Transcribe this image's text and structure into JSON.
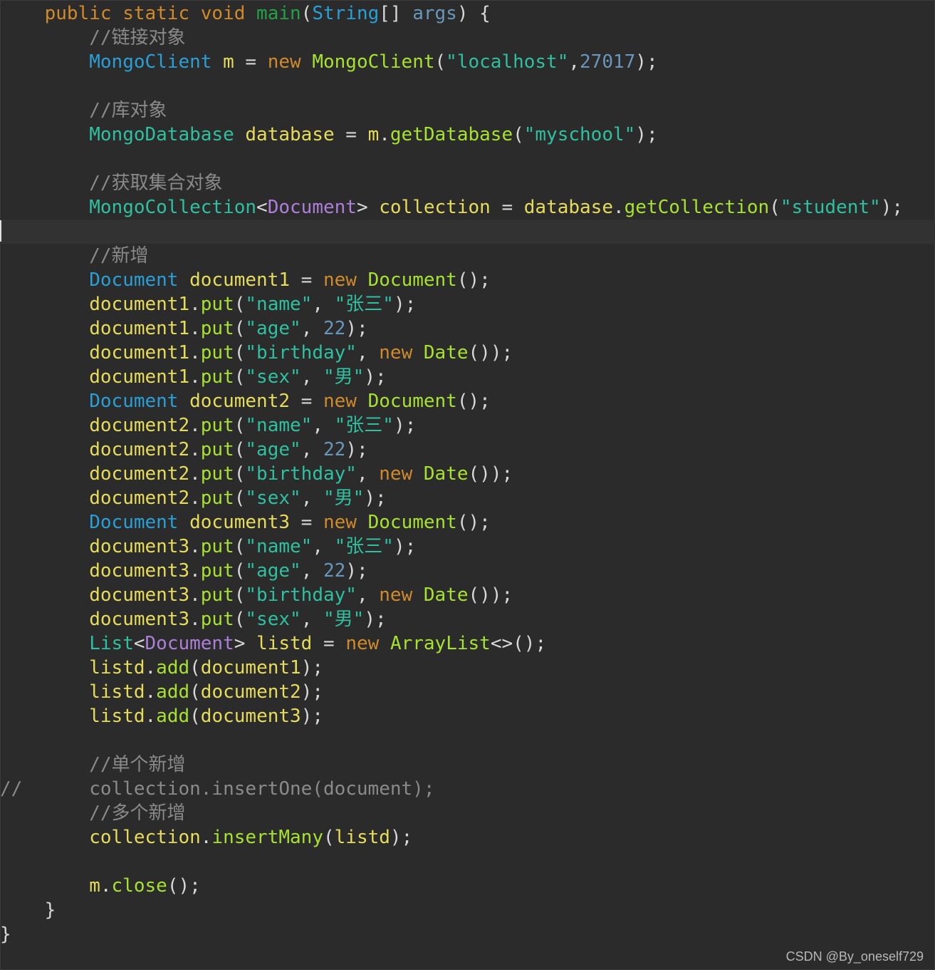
{
  "editor": {
    "theme_colors": {
      "background": "#2b2b2b",
      "keyword": "#d08a2a",
      "method_decl": "#22a246",
      "type": "#2a9fd6",
      "type_generic": "#ad7fd8",
      "variable": "#e6dc5a",
      "method_call": "#a6e22e",
      "string": "#2ec0a0",
      "number": "#6897bb",
      "comment": "#8a8a8a",
      "plain": "#d8d8d8"
    },
    "current_line_index": 9,
    "lines": [
      [
        {
          "t": "    "
        },
        {
          "t": "public static void ",
          "c": "keyword"
        },
        {
          "t": "main",
          "c": "method_decl"
        },
        {
          "t": "("
        },
        {
          "t": "String",
          "c": "type"
        },
        {
          "t": "[] "
        },
        {
          "t": "args",
          "c": "number"
        },
        {
          "t": ") {"
        }
      ],
      [
        {
          "t": "        "
        },
        {
          "t": "//链接对象",
          "c": "comment"
        }
      ],
      [
        {
          "t": "        "
        },
        {
          "t": "MongoClient",
          "c": "type"
        },
        {
          "t": " "
        },
        {
          "t": "m",
          "c": "variable"
        },
        {
          "t": " = "
        },
        {
          "t": "new ",
          "c": "keyword"
        },
        {
          "t": "MongoClient",
          "c": "method_call"
        },
        {
          "t": "("
        },
        {
          "t": "\"localhost\"",
          "c": "string"
        },
        {
          "t": ","
        },
        {
          "t": "27017",
          "c": "number"
        },
        {
          "t": ");"
        }
      ],
      [
        {
          "t": ""
        }
      ],
      [
        {
          "t": "        "
        },
        {
          "t": "//库对象",
          "c": "comment"
        }
      ],
      [
        {
          "t": "        "
        },
        {
          "t": "MongoDatabase",
          "c": "string"
        },
        {
          "t": " "
        },
        {
          "t": "database",
          "c": "variable"
        },
        {
          "t": " = "
        },
        {
          "t": "m",
          "c": "variable"
        },
        {
          "t": "."
        },
        {
          "t": "getDatabase",
          "c": "method_call"
        },
        {
          "t": "("
        },
        {
          "t": "\"myschool\"",
          "c": "string"
        },
        {
          "t": ");"
        }
      ],
      [
        {
          "t": ""
        }
      ],
      [
        {
          "t": "        "
        },
        {
          "t": "//获取集合对象",
          "c": "comment"
        }
      ],
      [
        {
          "t": "        "
        },
        {
          "t": "MongoCollection",
          "c": "string"
        },
        {
          "t": "<"
        },
        {
          "t": "Document",
          "c": "type_generic"
        },
        {
          "t": "> "
        },
        {
          "t": "collection",
          "c": "variable"
        },
        {
          "t": " = "
        },
        {
          "t": "database",
          "c": "variable"
        },
        {
          "t": "."
        },
        {
          "t": "getCollection",
          "c": "method_call"
        },
        {
          "t": "("
        },
        {
          "t": "\"student\"",
          "c": "string"
        },
        {
          "t": ");"
        }
      ],
      [
        {
          "t": ""
        }
      ],
      [
        {
          "t": "        "
        },
        {
          "t": "//新增",
          "c": "comment"
        }
      ],
      [
        {
          "t": "        "
        },
        {
          "t": "Document",
          "c": "type"
        },
        {
          "t": " "
        },
        {
          "t": "document1",
          "c": "variable"
        },
        {
          "t": " = "
        },
        {
          "t": "new ",
          "c": "keyword"
        },
        {
          "t": "Document",
          "c": "method_call"
        },
        {
          "t": "();"
        }
      ],
      [
        {
          "t": "        "
        },
        {
          "t": "document1",
          "c": "variable"
        },
        {
          "t": "."
        },
        {
          "t": "put",
          "c": "method_call"
        },
        {
          "t": "("
        },
        {
          "t": "\"name\"",
          "c": "string"
        },
        {
          "t": ", "
        },
        {
          "t": "\"张三\"",
          "c": "string"
        },
        {
          "t": ");"
        }
      ],
      [
        {
          "t": "        "
        },
        {
          "t": "document1",
          "c": "variable"
        },
        {
          "t": "."
        },
        {
          "t": "put",
          "c": "method_call"
        },
        {
          "t": "("
        },
        {
          "t": "\"age\"",
          "c": "string"
        },
        {
          "t": ", "
        },
        {
          "t": "22",
          "c": "number"
        },
        {
          "t": ");"
        }
      ],
      [
        {
          "t": "        "
        },
        {
          "t": "document1",
          "c": "variable"
        },
        {
          "t": "."
        },
        {
          "t": "put",
          "c": "method_call"
        },
        {
          "t": "("
        },
        {
          "t": "\"birthday\"",
          "c": "string"
        },
        {
          "t": ", "
        },
        {
          "t": "new ",
          "c": "keyword"
        },
        {
          "t": "Date",
          "c": "method_call"
        },
        {
          "t": "());"
        }
      ],
      [
        {
          "t": "        "
        },
        {
          "t": "document1",
          "c": "variable"
        },
        {
          "t": "."
        },
        {
          "t": "put",
          "c": "method_call"
        },
        {
          "t": "("
        },
        {
          "t": "\"sex\"",
          "c": "string"
        },
        {
          "t": ", "
        },
        {
          "t": "\"男\"",
          "c": "string"
        },
        {
          "t": ");"
        }
      ],
      [
        {
          "t": "        "
        },
        {
          "t": "Document",
          "c": "type"
        },
        {
          "t": " "
        },
        {
          "t": "document2",
          "c": "variable"
        },
        {
          "t": " = "
        },
        {
          "t": "new ",
          "c": "keyword"
        },
        {
          "t": "Document",
          "c": "method_call"
        },
        {
          "t": "();"
        }
      ],
      [
        {
          "t": "        "
        },
        {
          "t": "document2",
          "c": "variable"
        },
        {
          "t": "."
        },
        {
          "t": "put",
          "c": "method_call"
        },
        {
          "t": "("
        },
        {
          "t": "\"name\"",
          "c": "string"
        },
        {
          "t": ", "
        },
        {
          "t": "\"张三\"",
          "c": "string"
        },
        {
          "t": ");"
        }
      ],
      [
        {
          "t": "        "
        },
        {
          "t": "document2",
          "c": "variable"
        },
        {
          "t": "."
        },
        {
          "t": "put",
          "c": "method_call"
        },
        {
          "t": "("
        },
        {
          "t": "\"age\"",
          "c": "string"
        },
        {
          "t": ", "
        },
        {
          "t": "22",
          "c": "number"
        },
        {
          "t": ");"
        }
      ],
      [
        {
          "t": "        "
        },
        {
          "t": "document2",
          "c": "variable"
        },
        {
          "t": "."
        },
        {
          "t": "put",
          "c": "method_call"
        },
        {
          "t": "("
        },
        {
          "t": "\"birthday\"",
          "c": "string"
        },
        {
          "t": ", "
        },
        {
          "t": "new ",
          "c": "keyword"
        },
        {
          "t": "Date",
          "c": "method_call"
        },
        {
          "t": "());"
        }
      ],
      [
        {
          "t": "        "
        },
        {
          "t": "document2",
          "c": "variable"
        },
        {
          "t": "."
        },
        {
          "t": "put",
          "c": "method_call"
        },
        {
          "t": "("
        },
        {
          "t": "\"sex\"",
          "c": "string"
        },
        {
          "t": ", "
        },
        {
          "t": "\"男\"",
          "c": "string"
        },
        {
          "t": ");"
        }
      ],
      [
        {
          "t": "        "
        },
        {
          "t": "Document",
          "c": "type"
        },
        {
          "t": " "
        },
        {
          "t": "document3",
          "c": "variable"
        },
        {
          "t": " = "
        },
        {
          "t": "new ",
          "c": "keyword"
        },
        {
          "t": "Document",
          "c": "method_call"
        },
        {
          "t": "();"
        }
      ],
      [
        {
          "t": "        "
        },
        {
          "t": "document3",
          "c": "variable"
        },
        {
          "t": "."
        },
        {
          "t": "put",
          "c": "method_call"
        },
        {
          "t": "("
        },
        {
          "t": "\"name\"",
          "c": "string"
        },
        {
          "t": ", "
        },
        {
          "t": "\"张三\"",
          "c": "string"
        },
        {
          "t": ");"
        }
      ],
      [
        {
          "t": "        "
        },
        {
          "t": "document3",
          "c": "variable"
        },
        {
          "t": "."
        },
        {
          "t": "put",
          "c": "method_call"
        },
        {
          "t": "("
        },
        {
          "t": "\"age\"",
          "c": "string"
        },
        {
          "t": ", "
        },
        {
          "t": "22",
          "c": "number"
        },
        {
          "t": ");"
        }
      ],
      [
        {
          "t": "        "
        },
        {
          "t": "document3",
          "c": "variable"
        },
        {
          "t": "."
        },
        {
          "t": "put",
          "c": "method_call"
        },
        {
          "t": "("
        },
        {
          "t": "\"birthday\"",
          "c": "string"
        },
        {
          "t": ", "
        },
        {
          "t": "new ",
          "c": "keyword"
        },
        {
          "t": "Date",
          "c": "method_call"
        },
        {
          "t": "());"
        }
      ],
      [
        {
          "t": "        "
        },
        {
          "t": "document3",
          "c": "variable"
        },
        {
          "t": "."
        },
        {
          "t": "put",
          "c": "method_call"
        },
        {
          "t": "("
        },
        {
          "t": "\"sex\"",
          "c": "string"
        },
        {
          "t": ", "
        },
        {
          "t": "\"男\"",
          "c": "string"
        },
        {
          "t": ");"
        }
      ],
      [
        {
          "t": "        "
        },
        {
          "t": "List",
          "c": "string"
        },
        {
          "t": "<"
        },
        {
          "t": "Document",
          "c": "type_generic"
        },
        {
          "t": "> "
        },
        {
          "t": "listd",
          "c": "variable"
        },
        {
          "t": " = "
        },
        {
          "t": "new ",
          "c": "keyword"
        },
        {
          "t": "ArrayList",
          "c": "method_call"
        },
        {
          "t": "<>();"
        }
      ],
      [
        {
          "t": "        "
        },
        {
          "t": "listd",
          "c": "variable"
        },
        {
          "t": "."
        },
        {
          "t": "add",
          "c": "method_call"
        },
        {
          "t": "("
        },
        {
          "t": "document1",
          "c": "variable"
        },
        {
          "t": ");"
        }
      ],
      [
        {
          "t": "        "
        },
        {
          "t": "listd",
          "c": "variable"
        },
        {
          "t": "."
        },
        {
          "t": "add",
          "c": "method_call"
        },
        {
          "t": "("
        },
        {
          "t": "document2",
          "c": "variable"
        },
        {
          "t": ");"
        }
      ],
      [
        {
          "t": "        "
        },
        {
          "t": "listd",
          "c": "variable"
        },
        {
          "t": "."
        },
        {
          "t": "add",
          "c": "method_call"
        },
        {
          "t": "("
        },
        {
          "t": "document3",
          "c": "variable"
        },
        {
          "t": ");"
        }
      ],
      [
        {
          "t": ""
        }
      ],
      [
        {
          "t": "        "
        },
        {
          "t": "//单个新增",
          "c": "comment"
        }
      ],
      [
        {
          "t": "//      collection.insertOne(document);",
          "c": "comment"
        }
      ],
      [
        {
          "t": "        "
        },
        {
          "t": "//多个新增",
          "c": "comment"
        }
      ],
      [
        {
          "t": "        "
        },
        {
          "t": "collection",
          "c": "variable"
        },
        {
          "t": "."
        },
        {
          "t": "insertMany",
          "c": "method_call"
        },
        {
          "t": "("
        },
        {
          "t": "listd",
          "c": "variable"
        },
        {
          "t": ");"
        }
      ],
      [
        {
          "t": ""
        }
      ],
      [
        {
          "t": "        "
        },
        {
          "t": "m",
          "c": "variable"
        },
        {
          "t": "."
        },
        {
          "t": "close",
          "c": "method_call"
        },
        {
          "t": "();"
        }
      ],
      [
        {
          "t": "    }"
        }
      ],
      [
        {
          "t": "}"
        }
      ]
    ]
  },
  "watermark": "CSDN @By_oneself729"
}
